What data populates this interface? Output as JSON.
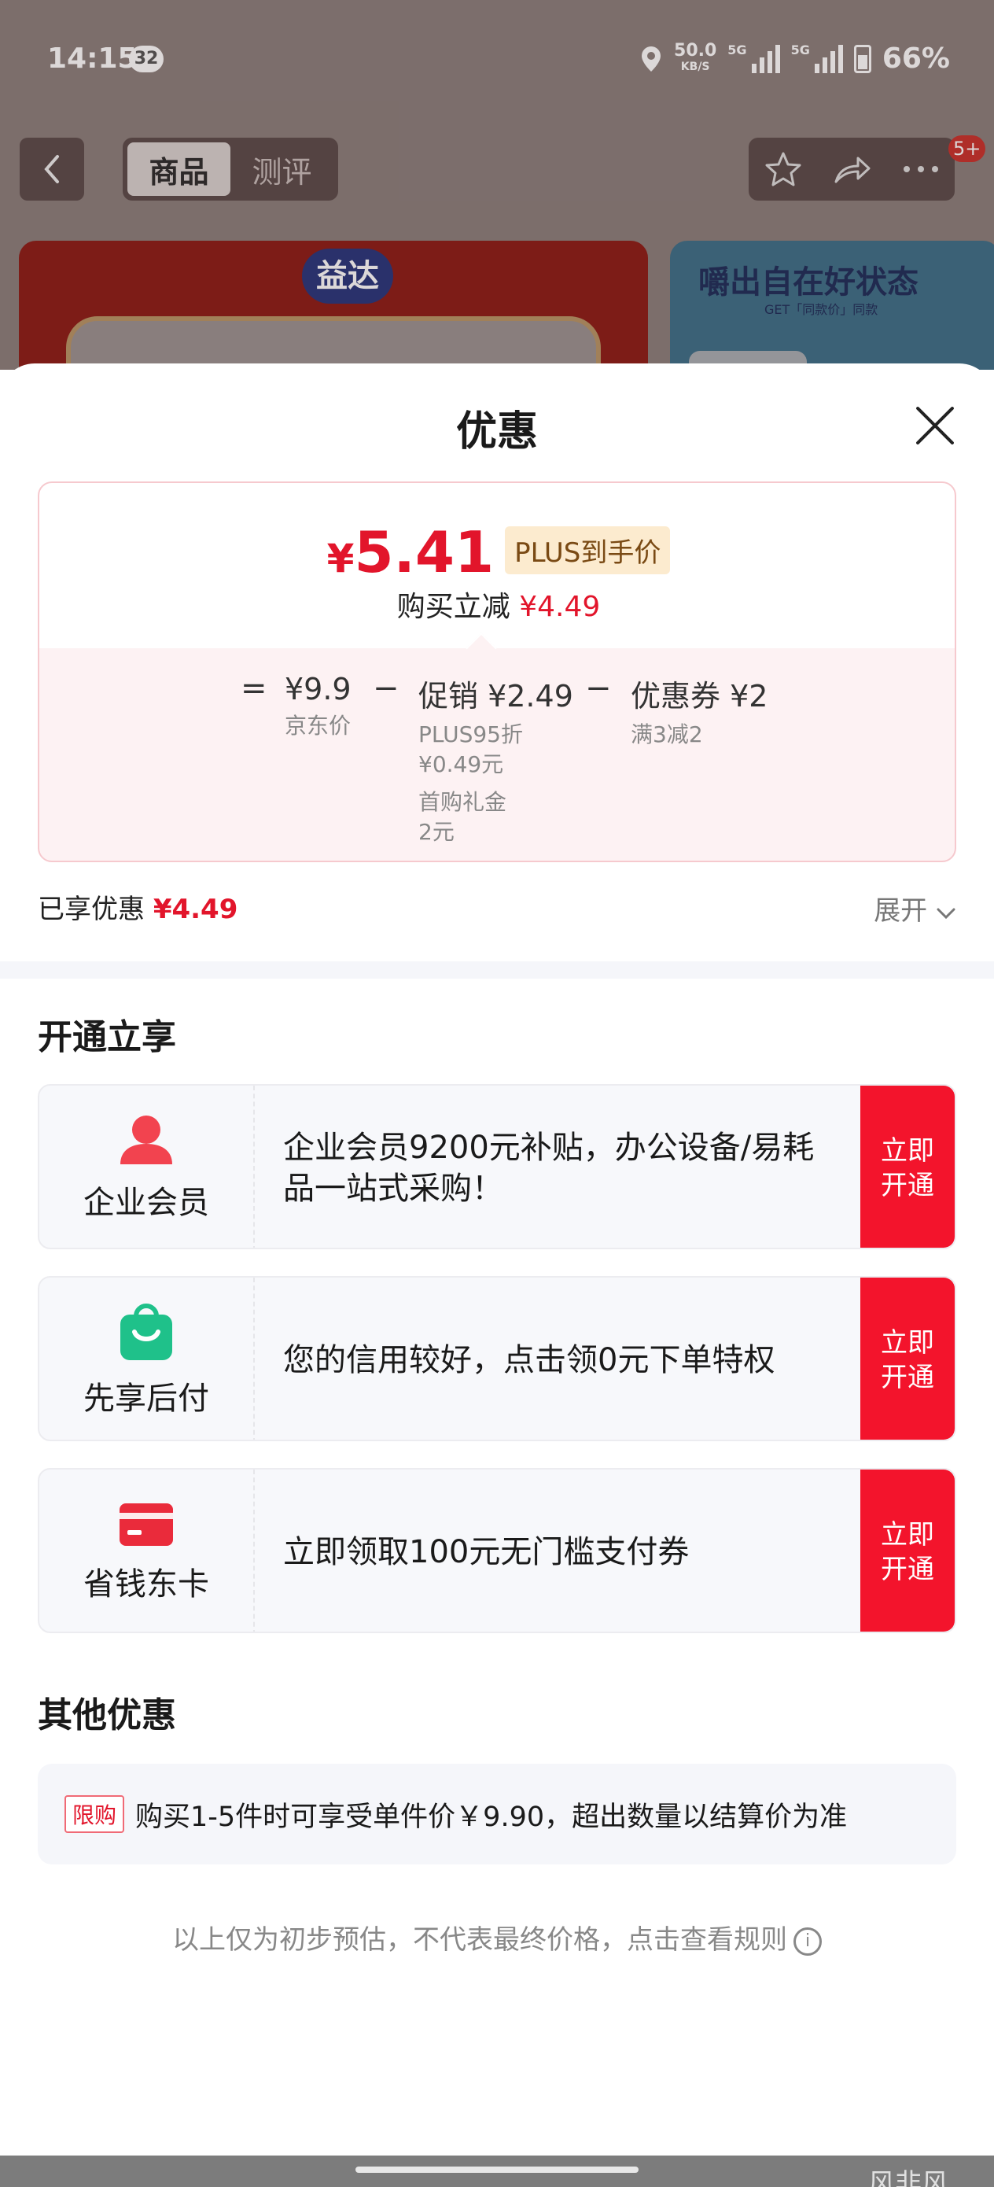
{
  "status_bar": {
    "time": "14:15",
    "notification_count": "32",
    "speed_value": "50.0",
    "speed_unit": "KB/S",
    "net1": "5G",
    "net2": "5G",
    "battery": "66%"
  },
  "background": {
    "tabs": [
      {
        "label": "商品",
        "active": true
      },
      {
        "label": "测评",
        "active": false
      }
    ],
    "badge": "5+",
    "banner_left_logo": "益达",
    "banner_right_title": "嚼出自在好状态",
    "banner_right_sub": "GET「同款价」同款"
  },
  "sheet": {
    "title": "优惠",
    "price": {
      "currency": "¥",
      "final": "5.41",
      "tag": "PLUS到手价",
      "instant_label": "购买立减",
      "instant_value": "¥4.49"
    },
    "formula": {
      "eq": "=",
      "jd_price": "¥9.9",
      "jd_label": "京东价",
      "minus1": "−",
      "promo": "促销 ¥2.49",
      "promo_detail1": "PLUS95折",
      "promo_detail2": "¥0.49元",
      "promo_detail3": "首购礼金",
      "promo_detail4": "2元",
      "minus2": "−",
      "coupon": "优惠券 ¥2",
      "coupon_detail": "满3减2"
    },
    "enjoyed_label": "已享优惠",
    "enjoyed_value": "¥4.49",
    "expand_label": "展开",
    "open_section_title": "开通立享",
    "memberships": [
      {
        "name": "企业会员",
        "desc": "企业会员9200元补贴，办公设备/易耗品一站式采购！",
        "btn": "立即开通",
        "icon": "person-icon",
        "color": "#f2434f"
      },
      {
        "name": "先享后付",
        "desc": "您的信用较好，点击领0元下单特权",
        "btn": "立即开通",
        "icon": "shopping-bag-icon",
        "color": "#1fc18a"
      },
      {
        "name": "省钱东卡",
        "desc": "立即领取100元无门槛支付券",
        "btn": "立即开通",
        "icon": "card-icon",
        "color": "#ea2b3b"
      }
    ],
    "other_section_title": "其他优惠",
    "other_tag": "限购",
    "other_text": "购买1-5件时可享受单件价￥9.90，超出数量以结算价为准",
    "footnote": "以上仅为初步预估，不代表最终价格，点击查看规则",
    "watermark": "风非风"
  },
  "colors": {
    "accent_red": "#e2152b",
    "button_red": "#f3142c",
    "plus_tag_bg": "#fcebcf"
  }
}
